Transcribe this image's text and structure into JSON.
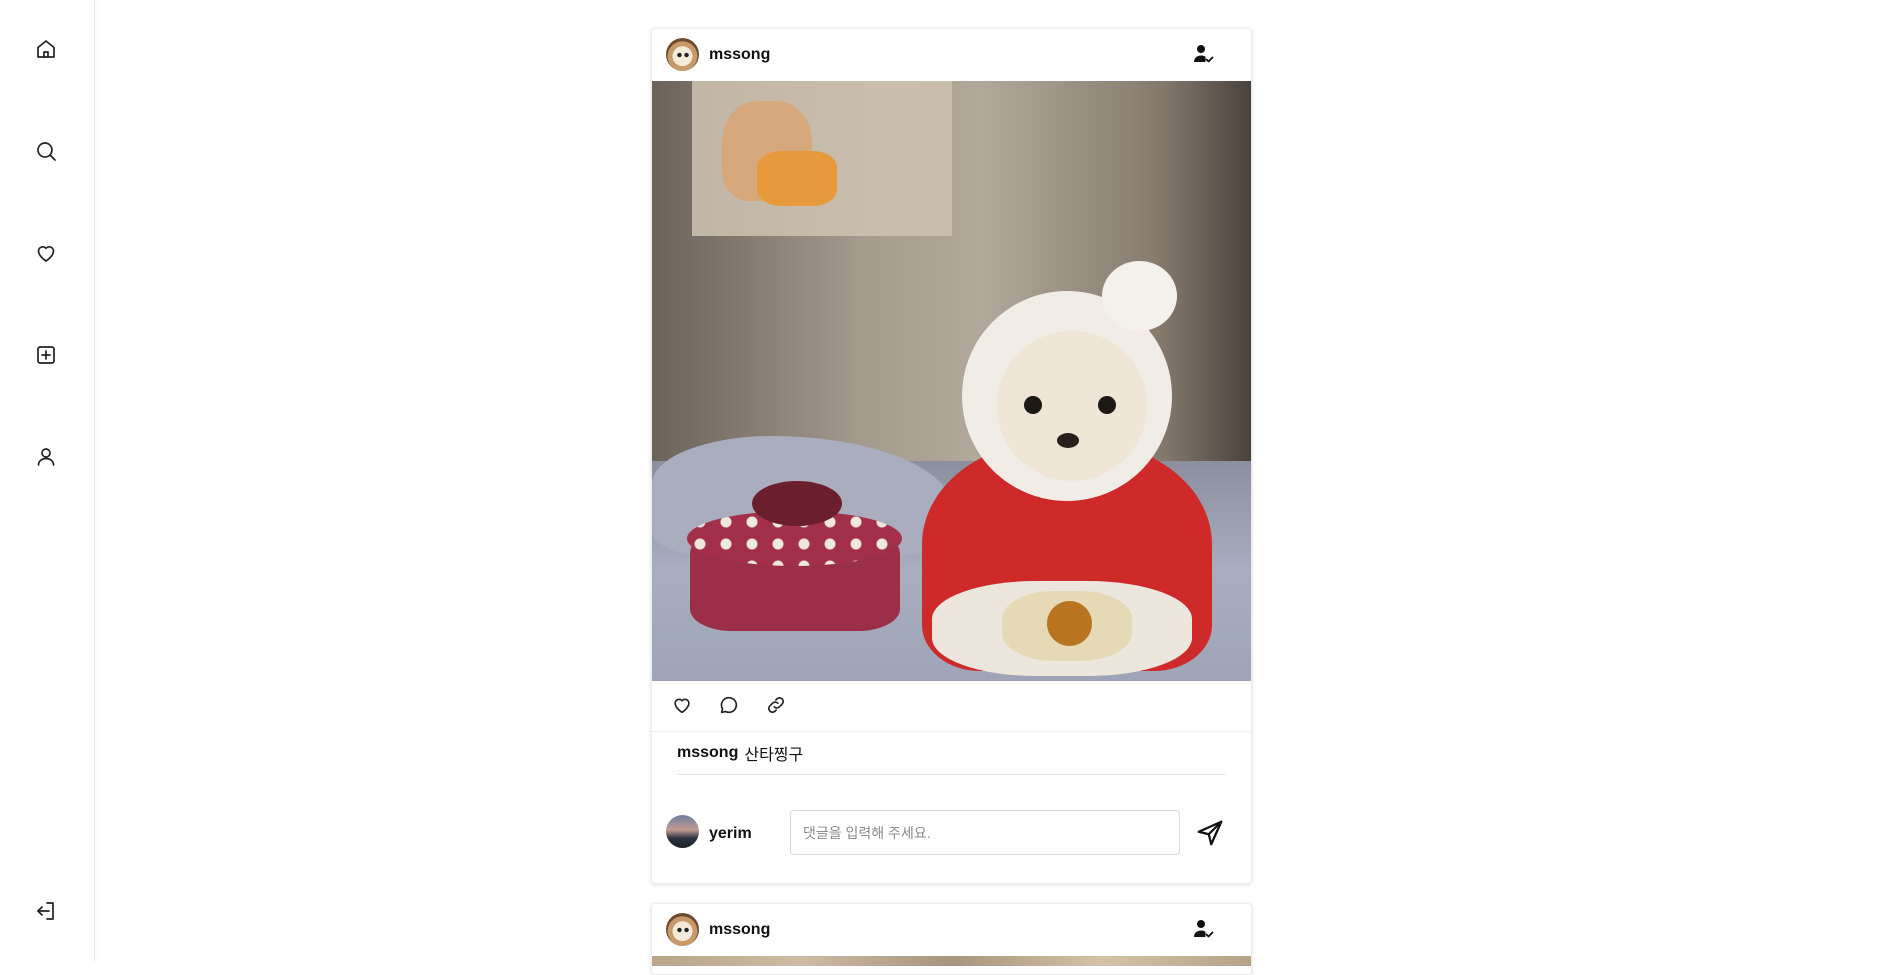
{
  "sidebar": {
    "items": [
      {
        "name": "home",
        "icon": "home-icon"
      },
      {
        "name": "search",
        "icon": "search-icon"
      },
      {
        "name": "likes",
        "icon": "heart-icon"
      },
      {
        "name": "create",
        "icon": "plus-square-icon"
      },
      {
        "name": "profile",
        "icon": "user-icon"
      }
    ],
    "logout": {
      "icon": "logout-icon"
    }
  },
  "posts": [
    {
      "author": "mssong",
      "follow_icon": "user-check-icon",
      "caption_user": "mssong",
      "caption_text": "산타찡구",
      "comment_user": "yerim",
      "comment_placeholder": "댓글을 입력해 주세요.",
      "comment_value": ""
    },
    {
      "author": "mssong",
      "follow_icon": "user-check-icon"
    }
  ],
  "colors": {
    "background": "#ffffff",
    "border": "#ececec",
    "text": "#111111",
    "placeholder": "#8a8a8a"
  }
}
